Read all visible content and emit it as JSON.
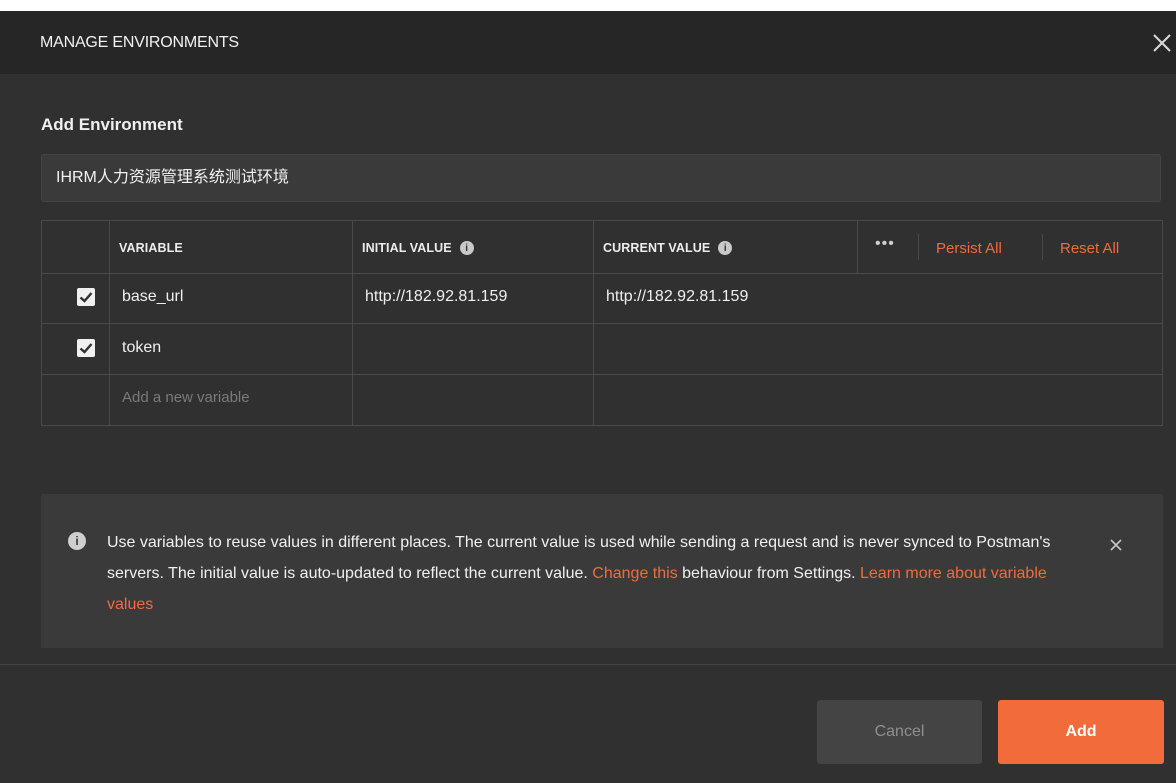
{
  "header": {
    "title": "MANAGE ENVIRONMENTS",
    "close_icon": "close-icon"
  },
  "section_title": "Add Environment",
  "environment_name": "IHRM人力资源管理系统测试环境",
  "table": {
    "columns": {
      "variable": "VARIABLE",
      "initial_value": "INITIAL VALUE",
      "current_value": "CURRENT VALUE",
      "info_icon_glyph": "i"
    },
    "more_actions": "•••",
    "persist_all": "Persist All",
    "reset_all": "Reset All",
    "rows": [
      {
        "checked": true,
        "variable": "base_url",
        "initial_value": "http://182.92.81.159",
        "current_value": "http://182.92.81.159"
      },
      {
        "checked": true,
        "variable": "token",
        "initial_value": "",
        "current_value": ""
      }
    ],
    "new_variable_placeholder": "Add a new variable"
  },
  "info_box": {
    "icon_glyph": "i",
    "text_1": "Use variables to reuse values in different places. The current value is used while sending a request and is never synced to Postman's servers. The initial value is auto-updated to reflect the current value. ",
    "link_1": "Change this",
    "text_2": " behaviour from Settings. ",
    "link_2": "Learn more about variable values"
  },
  "footer": {
    "cancel_label": "Cancel",
    "add_label": "Add"
  },
  "colors": {
    "accent": "#f26b3a",
    "background": "#303030",
    "header": "#262626"
  }
}
